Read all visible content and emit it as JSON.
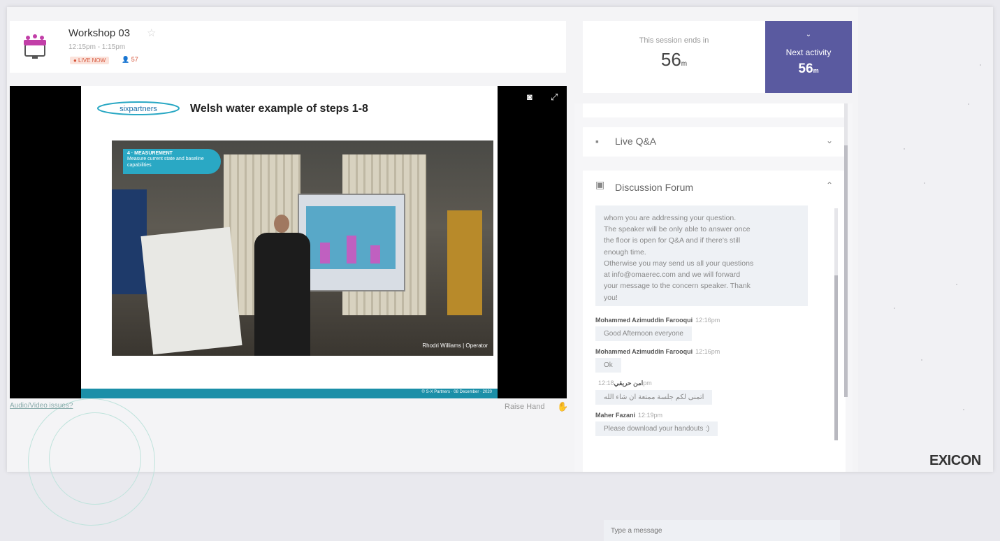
{
  "session": {
    "title": "Workshop 03",
    "time": "12:15pm - 1:15pm",
    "live_badge": "● LIVE NOW",
    "attendee_count": "57",
    "icon": "conference-room-icon"
  },
  "video": {
    "slide_title": "Welsh water example of steps 1-8",
    "logo_text": "sixpartners",
    "step_tag_title": "4 · MEASUREMENT",
    "step_tag_text": "Measure current state and baseline capabilities",
    "caption": "Rhodri Williams | Operator",
    "footer_text": "© S-X Partners · 08 December · 2020"
  },
  "below_video": {
    "audio_link": "Audio/Video issues?",
    "raise_hand": "Raise Hand"
  },
  "timer": {
    "label": "This session ends in",
    "value": "56",
    "unit": "m"
  },
  "next_activity": {
    "label": "Next activity",
    "value": "56",
    "unit": "m"
  },
  "panels": {
    "live_qa": "Live Q&A",
    "forum": "Discussion Forum"
  },
  "forum": {
    "first_message_lines": [
      "whom you are addressing your question.",
      "The speaker will be only able to answer once",
      "the floor is open for Q&A and if there's still",
      "enough time.",
      "Otherwise you may send us all your questions",
      "at info@omaerec.com and we will forward",
      "your message to the concern speaker. Thank",
      "you!"
    ],
    "messages": [
      {
        "sender": "Mohammed Azimuddin Farooqui",
        "time": "12:16pm",
        "text": "Good Afternoon everyone"
      },
      {
        "sender": "Mohammed Azimuddin Farooqui",
        "time": "12:16pm",
        "text": "Ok"
      },
      {
        "sender": "امن حريقي",
        "time": "12:18pm",
        "text": "اتمنى لكم جلسة ممتعة ان شاء الله"
      },
      {
        "sender": "Maher Fazani",
        "time": "12:19pm",
        "text": "Please download your handouts :)"
      }
    ],
    "input_placeholder": "Type a message"
  },
  "brand": "EXICON",
  "colors": {
    "accent_purple": "#5a5aa0",
    "live_red": "#d6553a",
    "teal": "#1b8fa8",
    "hand_green": "#2fb36a"
  }
}
